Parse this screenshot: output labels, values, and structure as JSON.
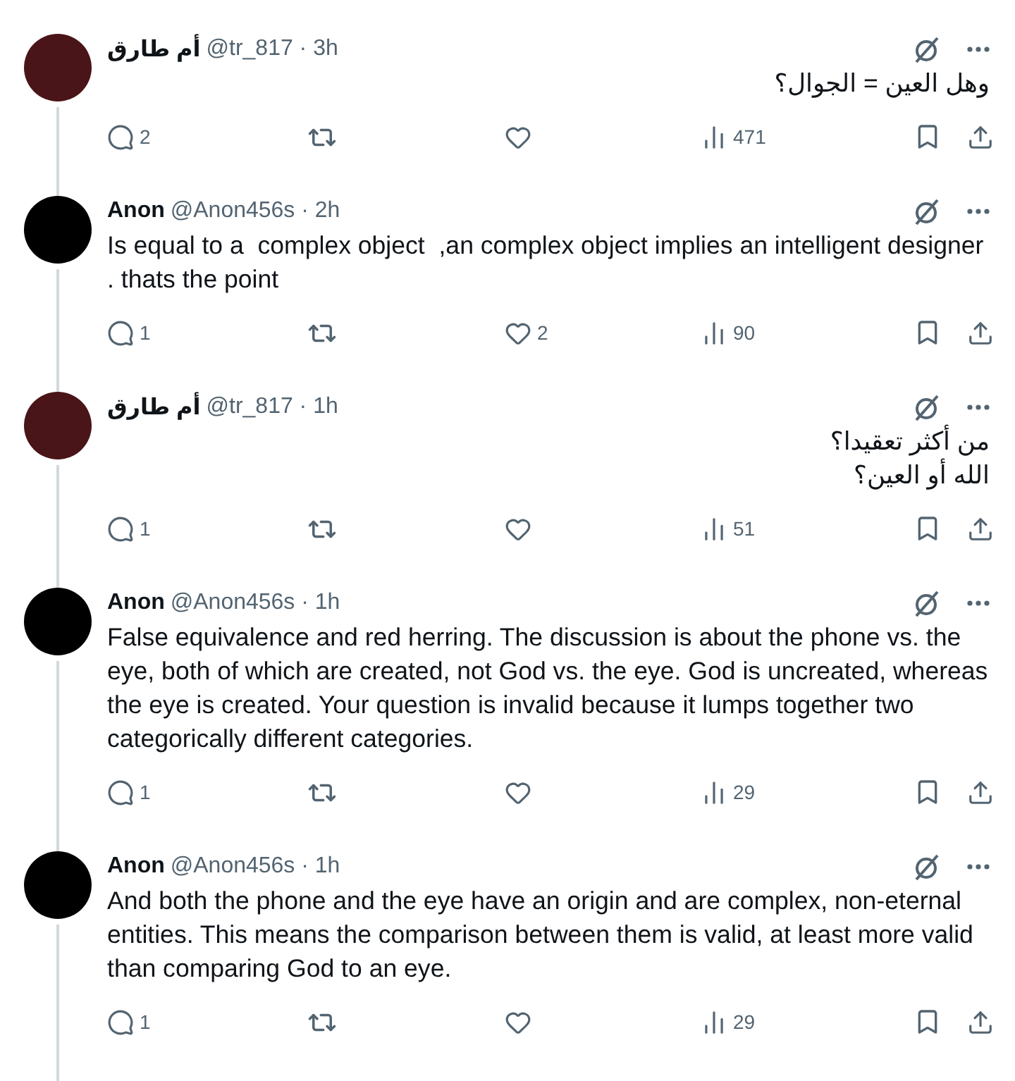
{
  "thread": [
    {
      "name": "أم طارق",
      "byline": "@tr_817 · 3h",
      "color": "#4a1518",
      "text": "وهل العين = الجوال؟",
      "replies": "2",
      "views": "471"
    },
    {
      "name": "Anon",
      "byline": "@Anon456s · 2h",
      "color": "#000000",
      "text": "Is equal to a  complex object  ,an complex object implies an intelligent designer . thats the point",
      "replies": "1",
      "likes": "2",
      "views": "90"
    },
    {
      "name": "أم طارق",
      "byline": "@tr_817 · 1h",
      "color": "#4a1518",
      "text": "من أكثر تعقيدا؟\nالله أو العين؟",
      "replies": "1",
      "views": "51"
    },
    {
      "name": "Anon",
      "byline": "@Anon456s · 1h",
      "color": "#000000",
      "text": "False equivalence and red herring. The discussion is about the phone vs. the eye, both of which are created, not God vs. the eye. God is uncreated, whereas the eye is created. Your question is invalid because it lumps together two categorically different categories.",
      "replies": "1",
      "views": "29"
    },
    {
      "name": "Anon",
      "byline": "@Anon456s · 1h",
      "color": "#000000",
      "text": "And both the phone and the eye have an origin and are complex, non-eternal entities. This means the comparison between them is valid, at least more valid than comparing God to an eye.",
      "replies": "1",
      "views": "29"
    }
  ]
}
